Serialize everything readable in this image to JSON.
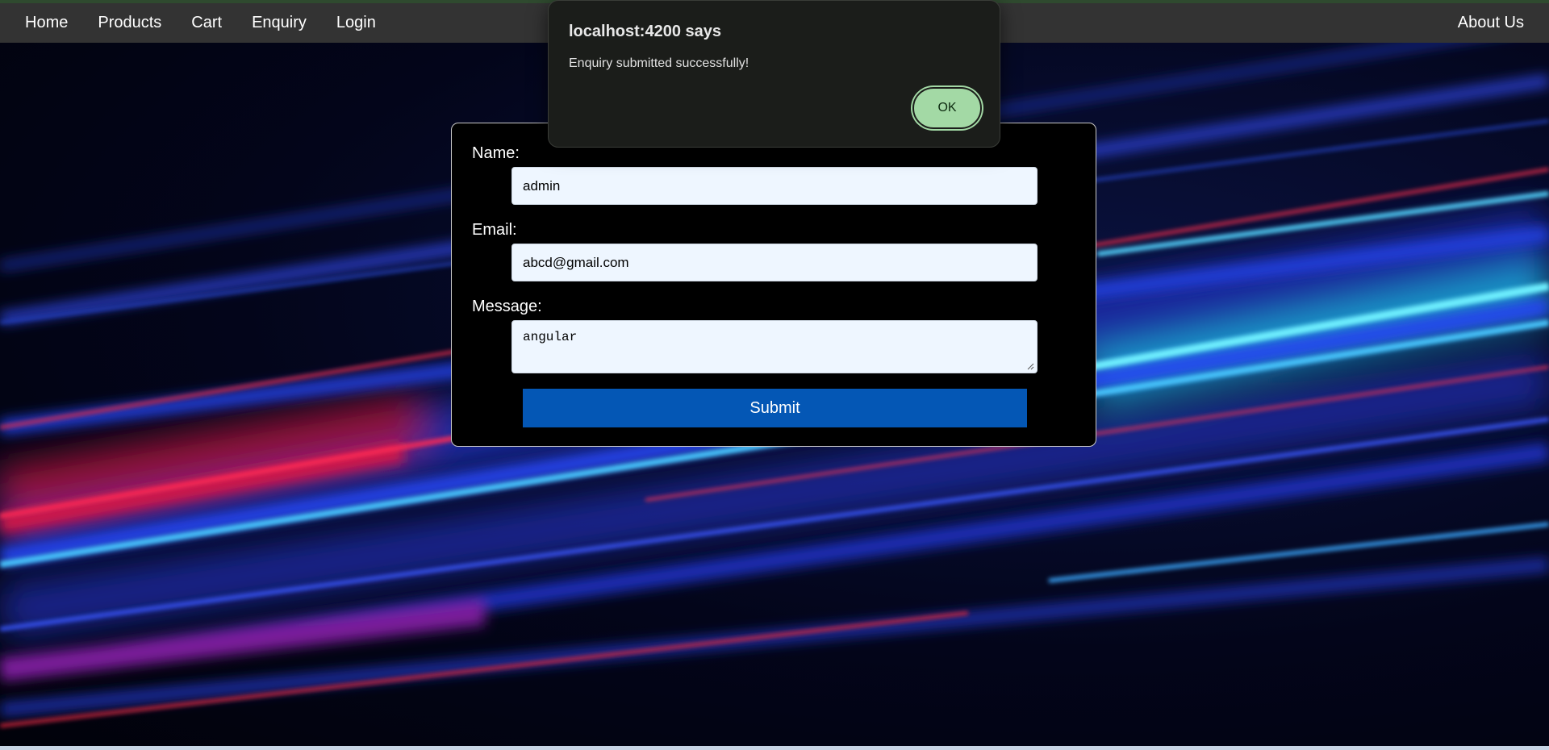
{
  "nav": {
    "links": [
      "Home",
      "Products",
      "Cart",
      "Enquiry",
      "Login"
    ],
    "right_link": "About Us"
  },
  "form": {
    "name_label": "Name:",
    "name_value": "admin",
    "email_label": "Email:",
    "email_value": "abcd@gmail.com",
    "message_label": "Message:",
    "message_value": "angular",
    "submit_label": "Submit"
  },
  "dialog": {
    "title": "localhost:4200 says",
    "message": "Enquiry submitted successfully!",
    "ok_label": "OK"
  },
  "colors": {
    "nav_bg": "#333333",
    "submit_bg": "#0457b5",
    "dialog_bg": "#1b1d1a",
    "ok_button": "#a3d9a5"
  }
}
